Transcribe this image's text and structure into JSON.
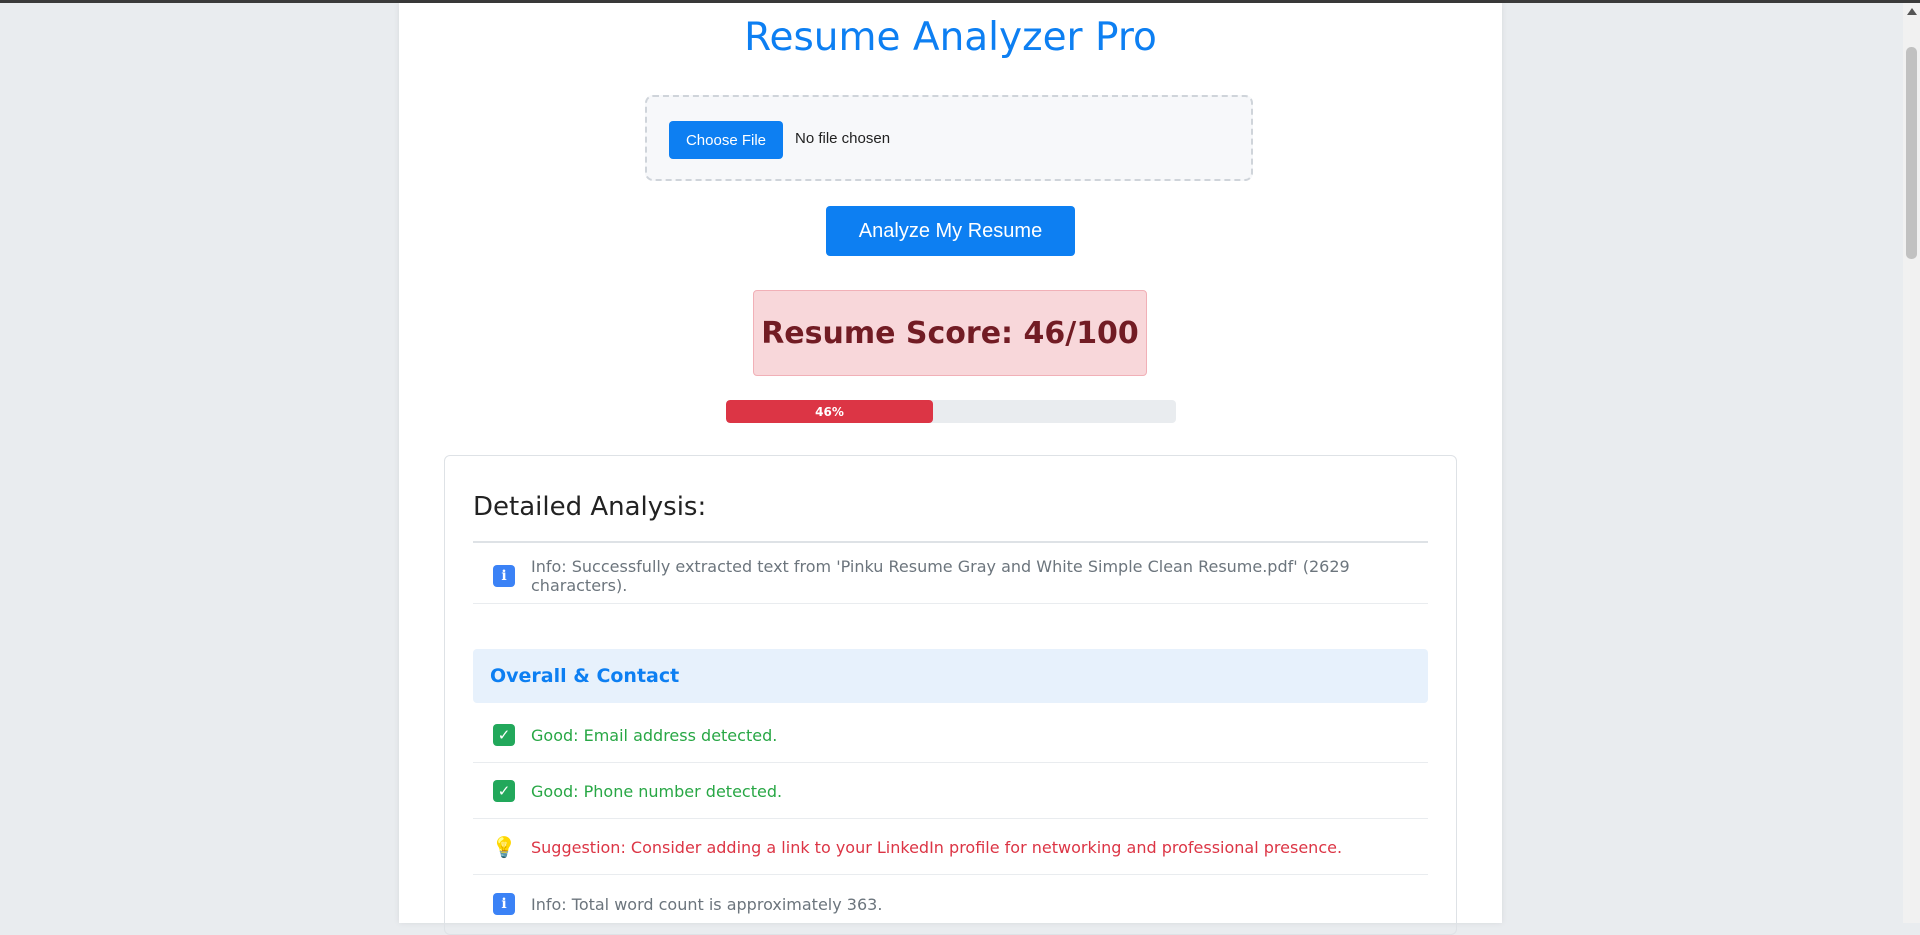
{
  "app": {
    "title": "Resume Analyzer Pro"
  },
  "upload": {
    "choose_label": "Choose File",
    "status": "No file chosen"
  },
  "analyze_button": "Analyze My Resume",
  "score": {
    "label": "Resume Score: 46/100",
    "value": 46,
    "max": 100,
    "progress_text": "46%",
    "progress_fraction": 0.46,
    "colors": {
      "bar": "#dc3545",
      "box_bg": "#f8d7da",
      "text": "#721c24"
    }
  },
  "analysis": {
    "heading": "Detailed Analysis:",
    "intro": {
      "icon": "info-icon",
      "text": "Info: Successfully extracted text from 'Pinku Resume Gray and White Simple Clean Resume.pdf' (2629 characters)."
    },
    "section_title": "Overall & Contact",
    "items": [
      {
        "icon": "check-icon",
        "type": "good",
        "text": "Good: Email address detected."
      },
      {
        "icon": "check-icon",
        "type": "good",
        "text": "Good: Phone number detected."
      },
      {
        "icon": "lightbulb-icon",
        "type": "suggestion",
        "text": "Suggestion: Consider adding a link to your LinkedIn profile for networking and professional presence."
      },
      {
        "icon": "info-icon",
        "type": "info",
        "text": "Info: Total word count is approximately 363."
      }
    ]
  },
  "colors": {
    "accent": "#0d7ff2",
    "good": "#28a745",
    "suggestion": "#dc3545",
    "info": "#6c757d"
  }
}
